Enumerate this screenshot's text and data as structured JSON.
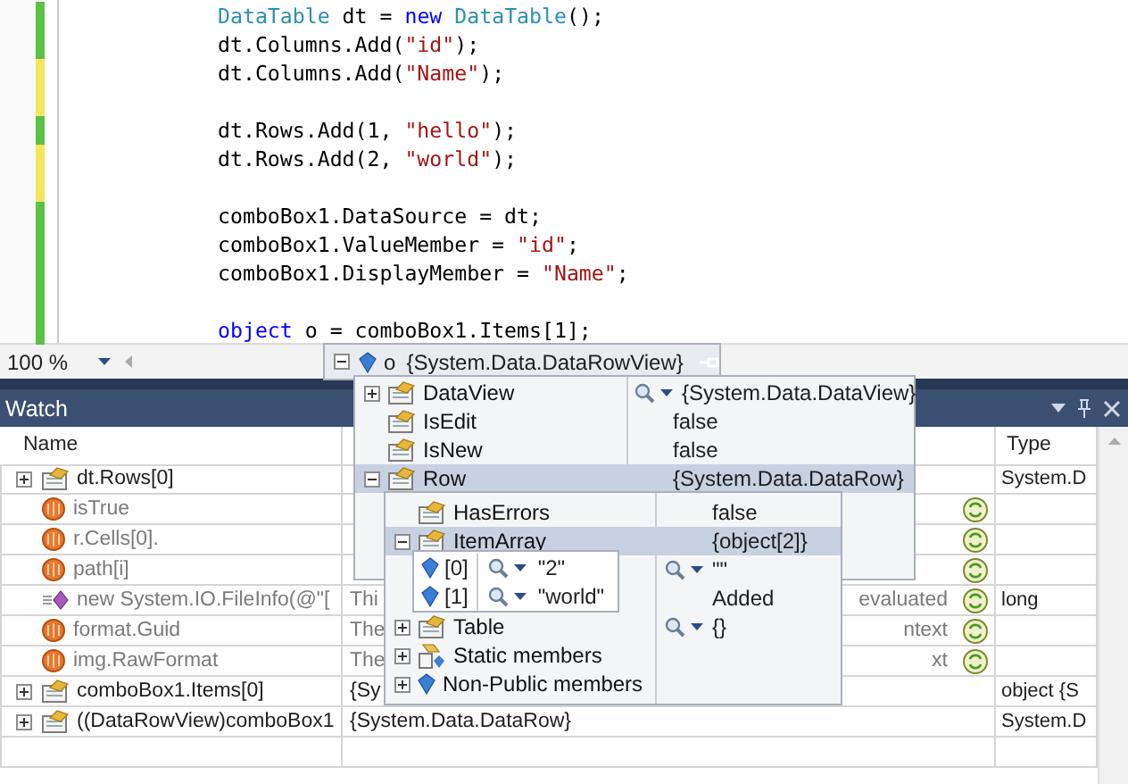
{
  "editor": {
    "lines": [
      {
        "color": "#5bc244",
        "tokens": [
          {
            "text": "DataTable",
            "kind": "type"
          },
          {
            "text": " dt = ",
            "kind": "plain"
          },
          {
            "text": "new",
            "kind": "keyword"
          },
          {
            "text": " DataTable",
            "kind": "type"
          },
          {
            "text": "();",
            "kind": "plain"
          }
        ]
      },
      {
        "color": "#5bc244",
        "tokens": [
          {
            "text": "dt.Columns.Add(",
            "kind": "plain"
          },
          {
            "text": "\"id\"",
            "kind": "string"
          },
          {
            "text": ");",
            "kind": "plain"
          }
        ]
      },
      {
        "color": "#f4e55a",
        "tokens": [
          {
            "text": "dt.Columns.Add(",
            "kind": "plain"
          },
          {
            "text": "\"Name\"",
            "kind": "string"
          },
          {
            "text": ");",
            "kind": "plain"
          }
        ]
      },
      {
        "color": "#f4e55a"
      },
      {
        "color": "#5bc244",
        "tokens": [
          {
            "text": "dt.Rows.Add(1, ",
            "kind": "plain"
          },
          {
            "text": "\"hello\"",
            "kind": "string"
          },
          {
            "text": ");",
            "kind": "plain"
          }
        ]
      },
      {
        "color": "#f4e55a",
        "tokens": [
          {
            "text": "dt.Rows.Add(2, ",
            "kind": "plain"
          },
          {
            "text": "\"world\"",
            "kind": "string"
          },
          {
            "text": ");",
            "kind": "plain"
          }
        ]
      },
      {
        "color": "#f4e55a"
      },
      {
        "color": "#5bc244",
        "tokens": [
          {
            "text": "comboBox1.DataSource = dt;",
            "kind": "plain"
          }
        ]
      },
      {
        "color": "#5bc244",
        "tokens": [
          {
            "text": "comboBox1.ValueMember = ",
            "kind": "plain"
          },
          {
            "text": "\"id\"",
            "kind": "string"
          },
          {
            "text": ";",
            "kind": "plain"
          }
        ]
      },
      {
        "color": "#5bc244",
        "tokens": [
          {
            "text": "comboBox1.DisplayMember = ",
            "kind": "plain"
          },
          {
            "text": "\"Name\"",
            "kind": "string"
          },
          {
            "text": ";",
            "kind": "plain"
          }
        ]
      },
      {
        "color": "#5bc244"
      },
      {
        "color": "#5bc244",
        "tokens": [
          {
            "text": "object",
            "kind": "keyword"
          },
          {
            "text": " o = comboBox1.Items[1];",
            "kind": "plain"
          }
        ]
      }
    ]
  },
  "zoom": {
    "value": "100 %"
  },
  "watch": {
    "title": "Watch",
    "columns": [
      "Name",
      "Type"
    ],
    "rows": [
      {
        "kind": "property",
        "expandable": true,
        "expanded": false,
        "name": "dt.Rows[0]",
        "dim": false,
        "refresh": false,
        "type": "System.D"
      },
      {
        "kind": "error",
        "expandable": false,
        "name": "isTrue",
        "dim": true,
        "refresh": true
      },
      {
        "kind": "error",
        "expandable": false,
        "name": "r.Cells[0].",
        "dim": true,
        "refresh": true
      },
      {
        "kind": "error",
        "expandable": false,
        "name": "path[i]",
        "dim": true,
        "refresh": true
      },
      {
        "kind": "method",
        "expandable": false,
        "name": "new System.IO.FileInfo(@\"[",
        "dim": true,
        "value_left": "Thi",
        "value_right": "evaluated",
        "refresh": true,
        "type": "long"
      },
      {
        "kind": "error",
        "expandable": false,
        "name": "format.Guid",
        "dim": true,
        "value_left": "The",
        "value_right": "ntext",
        "refresh": true
      },
      {
        "kind": "error",
        "expandable": false,
        "name": "img.RawFormat",
        "dim": true,
        "value_left": "The",
        "value_right": "xt",
        "refresh": true
      },
      {
        "kind": "property",
        "expandable": true,
        "expanded": false,
        "name": "comboBox1.Items[0]",
        "dim": false,
        "value_left": "{Sy",
        "refresh": false,
        "type": "object {S"
      },
      {
        "kind": "property",
        "expandable": true,
        "expanded": false,
        "name": "((DataRowView)comboBox1",
        "dim": false,
        "value_left": "{System.Data.DataRow}",
        "refresh": false,
        "type": "System.D"
      }
    ]
  },
  "datatip": {
    "expanded": true,
    "name": "o",
    "value": "{System.Data.DataRowView}",
    "members": [
      {
        "kind": "property",
        "expandable": true,
        "expanded": false,
        "name": "DataView",
        "viewer": true,
        "value": "{System.Data.DataView}",
        "selected": false
      },
      {
        "kind": "property",
        "expandable": false,
        "name": "IsEdit",
        "viewer": false,
        "value": "false",
        "selected": false
      },
      {
        "kind": "property",
        "expandable": false,
        "name": "IsNew",
        "viewer": false,
        "value": "false",
        "selected": false
      },
      {
        "kind": "property",
        "expandable": true,
        "expanded": true,
        "name": "Row",
        "viewer": false,
        "value": "{System.Data.DataRow}",
        "selected": true
      }
    ],
    "row_members": [
      {
        "kind": "property",
        "expandable": false,
        "name": "HasErrors",
        "viewer": false,
        "value": "false",
        "selected": false
      },
      {
        "kind": "property",
        "expandable": true,
        "expanded": true,
        "name": "ItemArray",
        "viewer": false,
        "value": "{object[2]}",
        "selected": true
      },
      {
        "viewer": true,
        "value": "\"\"",
        "selected": false
      },
      {
        "viewer": false,
        "value": "Added",
        "selected": false
      },
      {
        "kind": "property",
        "expandable": true,
        "expanded": false,
        "name": "Table",
        "viewer": true,
        "value": "{}",
        "selected": false
      },
      {
        "kind": "static",
        "expandable": true,
        "expanded": false,
        "name": "Static members",
        "selected": false
      },
      {
        "kind": "field",
        "expandable": true,
        "expanded": false,
        "name": "Non-Public members",
        "selected": false
      }
    ],
    "items": [
      {
        "index": "[0]",
        "value": "\"2\""
      },
      {
        "index": "[1]",
        "value": "\"world\""
      }
    ]
  }
}
